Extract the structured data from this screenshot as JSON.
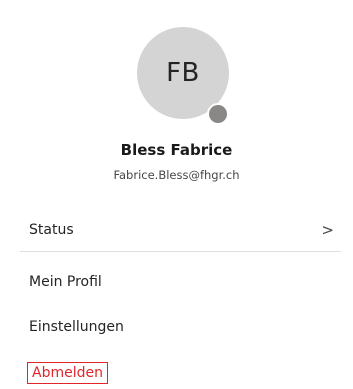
{
  "profile": {
    "initials": "FB",
    "name": "Bless Fabrice",
    "email": "Fabrice.Bless@fhgr.ch",
    "presence_color": "#8a8886"
  },
  "menu": {
    "status_label": "Status",
    "status_chevron": ">",
    "profile_label": "Mein Profil",
    "settings_label": "Einstellungen",
    "logout_label": "Abmelden"
  },
  "colors": {
    "accent_logout": "#e0262b",
    "avatar_bg": "#d4d4d4"
  }
}
